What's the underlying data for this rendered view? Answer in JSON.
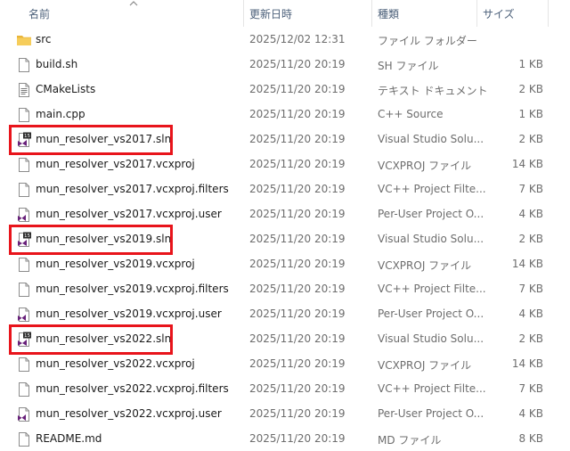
{
  "columns": {
    "name": "名前",
    "date": "更新日時",
    "type": "種類",
    "size": "サイズ"
  },
  "files": [
    {
      "icon": "folder-icon",
      "name": "src",
      "date": "2025/12/02 12:31",
      "type": "ファイル フォルダー",
      "size": ""
    },
    {
      "icon": "file-icon",
      "name": "build.sh",
      "date": "2025/11/20 20:19",
      "type": "SH ファイル",
      "size": "1 KB"
    },
    {
      "icon": "text-document-icon",
      "name": "CMakeLists",
      "date": "2025/11/20 20:19",
      "type": "テキスト ドキュメント",
      "size": "2 KB"
    },
    {
      "icon": "file-icon",
      "name": "main.cpp",
      "date": "2025/11/20 20:19",
      "type": "C++ Source",
      "size": "1 KB"
    },
    {
      "icon": "visual-studio-solution-icon",
      "name": "mun_resolver_vs2017.sln",
      "date": "2025/11/20 20:19",
      "type": "Visual Studio Solu...",
      "size": "2 KB"
    },
    {
      "icon": "file-icon",
      "name": "mun_resolver_vs2017.vcxproj",
      "date": "2025/11/20 20:19",
      "type": "VCXPROJ ファイル",
      "size": "14 KB"
    },
    {
      "icon": "file-icon",
      "name": "mun_resolver_vs2017.vcxproj.filters",
      "date": "2025/11/20 20:19",
      "type": "VC++ Project Filte...",
      "size": "7 KB"
    },
    {
      "icon": "vs-user-file-icon",
      "name": "mun_resolver_vs2017.vcxproj.user",
      "date": "2025/11/20 20:19",
      "type": "Per-User Project O...",
      "size": "4 KB"
    },
    {
      "icon": "visual-studio-solution-icon",
      "name": "mun_resolver_vs2019.sln",
      "date": "2025/11/20 20:19",
      "type": "Visual Studio Solu...",
      "size": "2 KB"
    },
    {
      "icon": "file-icon",
      "name": "mun_resolver_vs2019.vcxproj",
      "date": "2025/11/20 20:19",
      "type": "VCXPROJ ファイル",
      "size": "14 KB"
    },
    {
      "icon": "file-icon",
      "name": "mun_resolver_vs2019.vcxproj.filters",
      "date": "2025/11/20 20:19",
      "type": "VC++ Project Filte...",
      "size": "7 KB"
    },
    {
      "icon": "vs-user-file-icon",
      "name": "mun_resolver_vs2019.vcxproj.user",
      "date": "2025/11/20 20:19",
      "type": "Per-User Project O...",
      "size": "4 KB"
    },
    {
      "icon": "visual-studio-solution-icon",
      "name": "mun_resolver_vs2022.sln",
      "date": "2025/11/20 20:19",
      "type": "Visual Studio Solu...",
      "size": "2 KB"
    },
    {
      "icon": "file-icon",
      "name": "mun_resolver_vs2022.vcxproj",
      "date": "2025/11/20 20:19",
      "type": "VCXPROJ ファイル",
      "size": "14 KB"
    },
    {
      "icon": "file-icon",
      "name": "mun_resolver_vs2022.vcxproj.filters",
      "date": "2025/11/20 20:19",
      "type": "VC++ Project Filte...",
      "size": "7 KB"
    },
    {
      "icon": "vs-user-file-icon",
      "name": "mun_resolver_vs2022.vcxproj.user",
      "date": "2025/11/20 20:19",
      "type": "Per-User Project O...",
      "size": "4 KB"
    },
    {
      "icon": "file-icon",
      "name": "README.md",
      "date": "2025/11/20 20:19",
      "type": "MD ファイル",
      "size": "8 KB"
    }
  ],
  "highlighted_rows": [
    "mun_resolver_vs2017.sln",
    "mun_resolver_vs2019.sln",
    "mun_resolver_vs2022.sln"
  ],
  "colors": {
    "highlight": "#e8141b",
    "folder": "#f4c64f",
    "vs_purple": "#68217a",
    "header_text": "#4c607a"
  }
}
